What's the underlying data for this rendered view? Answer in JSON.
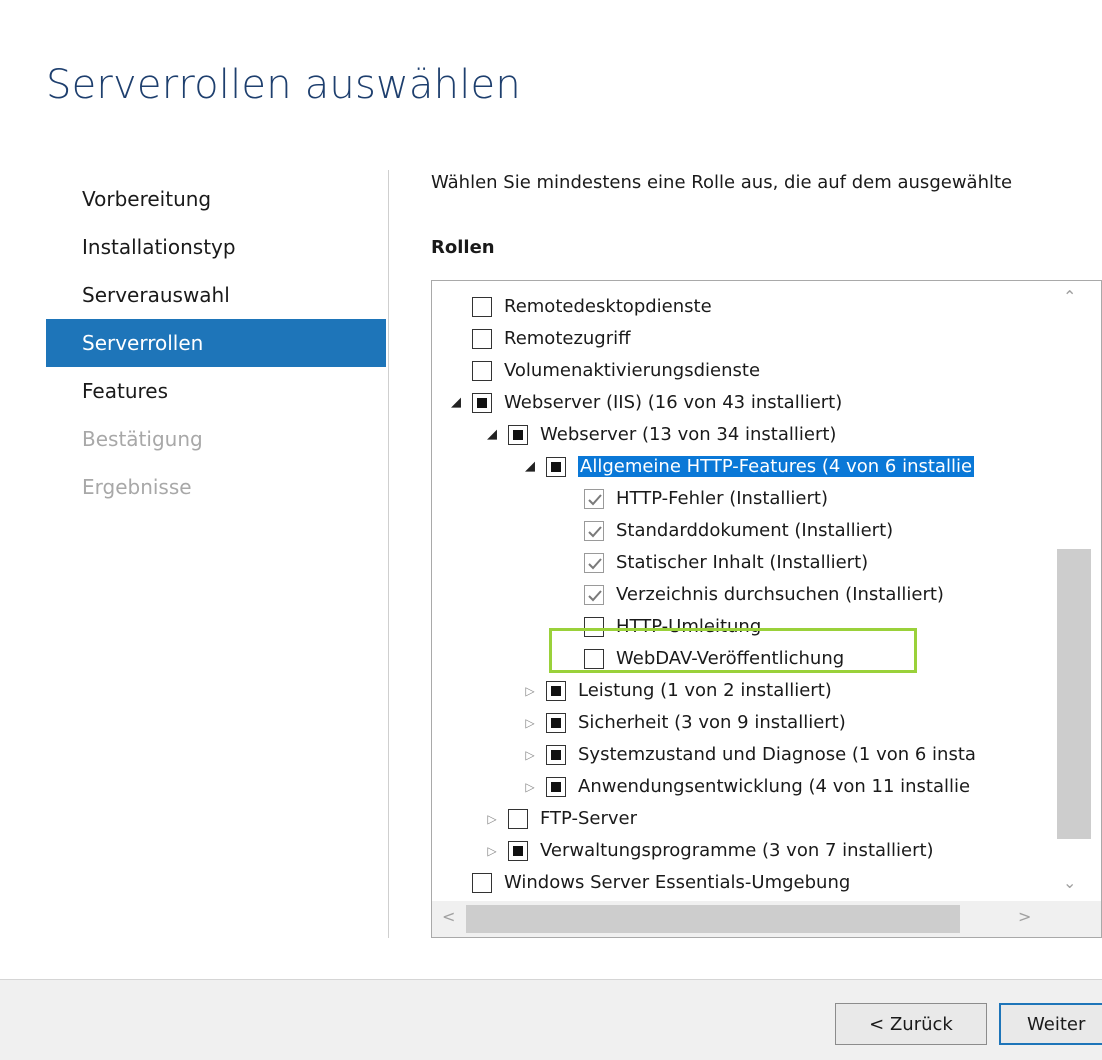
{
  "page": {
    "title": "Serverrollen auswählen"
  },
  "nav": {
    "items": [
      {
        "label": "Vorbereitung",
        "state": "normal"
      },
      {
        "label": "Installationstyp",
        "state": "normal"
      },
      {
        "label": "Serverauswahl",
        "state": "normal"
      },
      {
        "label": "Serverrollen",
        "state": "active"
      },
      {
        "label": "Features",
        "state": "normal"
      },
      {
        "label": "Bestätigung",
        "state": "disabled"
      },
      {
        "label": "Ergebnisse",
        "state": "disabled"
      }
    ]
  },
  "content": {
    "description": "Wählen Sie mindestens eine Rolle aus, die auf dem ausgewählte",
    "roles_label": "Rollen"
  },
  "tree": {
    "rows": [
      {
        "label": "Remotedesktopdienste",
        "level": 0,
        "expander": "none",
        "check": "unchecked"
      },
      {
        "label": "Remotezugriff",
        "level": 0,
        "expander": "none",
        "check": "unchecked"
      },
      {
        "label": "Volumenaktivierungsdienste",
        "level": 0,
        "expander": "none",
        "check": "unchecked"
      },
      {
        "label": "Webserver (IIS) (16 von 43 installiert)",
        "level": 0,
        "expander": "expanded",
        "check": "partial"
      },
      {
        "label": "Webserver (13 von 34 installiert)",
        "level": 1,
        "expander": "expanded",
        "check": "partial"
      },
      {
        "label": "Allgemeine HTTP-Features (4 von 6 installie",
        "level": 2,
        "expander": "expanded",
        "check": "partial",
        "selected": true
      },
      {
        "label": "HTTP-Fehler (Installiert)",
        "level": 3,
        "expander": "none",
        "check": "checked"
      },
      {
        "label": "Standarddokument (Installiert)",
        "level": 3,
        "expander": "none",
        "check": "checked"
      },
      {
        "label": "Statischer Inhalt (Installiert)",
        "level": 3,
        "expander": "none",
        "check": "checked"
      },
      {
        "label": "Verzeichnis durchsuchen (Installiert)",
        "level": 3,
        "expander": "none",
        "check": "checked"
      },
      {
        "label": "HTTP-Umleitung",
        "level": 3,
        "expander": "none",
        "check": "unchecked"
      },
      {
        "label": "WebDAV-Veröffentlichung",
        "level": 3,
        "expander": "none",
        "check": "unchecked",
        "highlighted": true
      },
      {
        "label": "Leistung (1 von 2 installiert)",
        "level": 2,
        "expander": "collapsed",
        "check": "partial"
      },
      {
        "label": "Sicherheit (3 von 9 installiert)",
        "level": 2,
        "expander": "collapsed",
        "check": "partial"
      },
      {
        "label": "Systemzustand und Diagnose (1 von 6 insta",
        "level": 2,
        "expander": "collapsed",
        "check": "partial"
      },
      {
        "label": "Anwendungsentwicklung (4 von 11 installie",
        "level": 2,
        "expander": "collapsed",
        "check": "partial"
      },
      {
        "label": "FTP-Server",
        "level": 1,
        "expander": "collapsed",
        "check": "unchecked"
      },
      {
        "label": "Verwaltungsprogramme (3 von 7 installiert)",
        "level": 1,
        "expander": "collapsed",
        "check": "partial"
      },
      {
        "label": "Windows Server Essentials-Umgebung",
        "level": 0,
        "expander": "none",
        "check": "unchecked"
      }
    ]
  },
  "footer": {
    "back_label": "< Zurück",
    "next_label": "Weiter"
  },
  "icons": {
    "expanded": "triangle-down-right-icon",
    "collapsed": "triangle-right-outline-icon",
    "scroll_up": "chevron-up-icon",
    "scroll_down": "chevron-down-icon",
    "scroll_left": "chevron-left-icon",
    "scroll_right": "chevron-right-icon"
  },
  "colors": {
    "title": "#1e3f6e",
    "nav_active_bg": "#1e75b9",
    "selection_bg": "#0a78d7",
    "highlight_border": "#9ad13a"
  }
}
